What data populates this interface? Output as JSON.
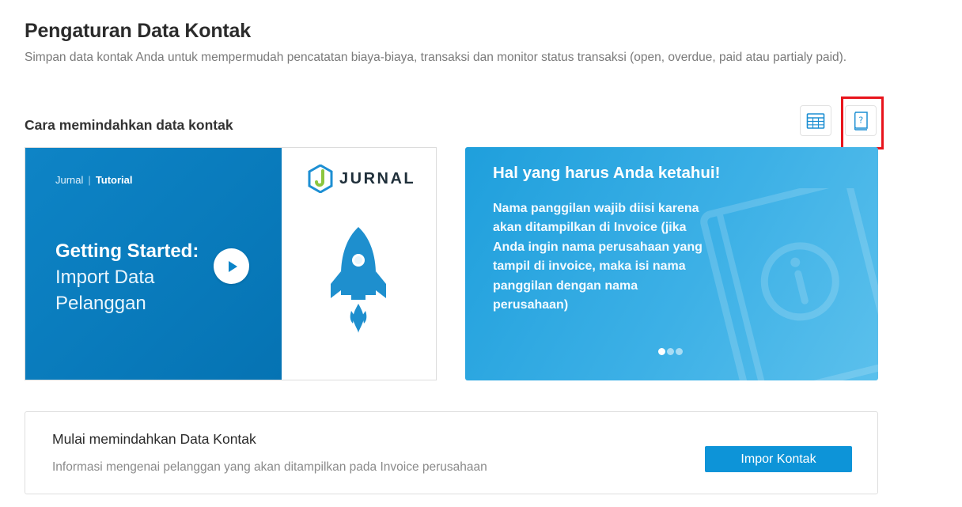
{
  "header": {
    "title": "Pengaturan Data Kontak",
    "description": "Simpan data kontak Anda untuk mempermudah pencatatan biaya-biaya, transaksi dan monitor status transaksi (open, overdue, paid atau partialy paid)."
  },
  "section": {
    "title": "Cara memindahkan data kontak"
  },
  "toolbar": {
    "icons": [
      "spreadsheet-icon",
      "help-book-icon"
    ],
    "highlight_color": "#e8141c"
  },
  "tutorial": {
    "brand": "Jurnal",
    "separator": "|",
    "tag": "Tutorial",
    "heading_bold": "Getting Started:",
    "heading_line1": "Import Data",
    "heading_line2": "Pelanggan",
    "logo_text": "JURNAL",
    "icons": [
      "play-icon",
      "jurnal-logo-icon",
      "rocket-icon"
    ]
  },
  "info": {
    "title": "Hal yang harus Anda ketahui!",
    "text": "Nama panggilan wajib diisi karena akan ditampilkan di Invoice (jika Anda ingin nama perusahaan yang tampil di invoice, maka isi nama panggilan dengan nama perusahaan)",
    "slide_count": 3,
    "active_slide": 1
  },
  "import_panel": {
    "title": "Mulai memindahkan Data Kontak",
    "description": "Informasi mengenai pelanggan yang akan ditampilkan pada Invoice perusahaan",
    "button_label": "Impor Kontak"
  },
  "colors": {
    "primary": "#0d94d8",
    "tutorial_bg": "#0a7dbf",
    "info_bg": "#3cb0e6",
    "logo_green": "#8cc63f"
  }
}
